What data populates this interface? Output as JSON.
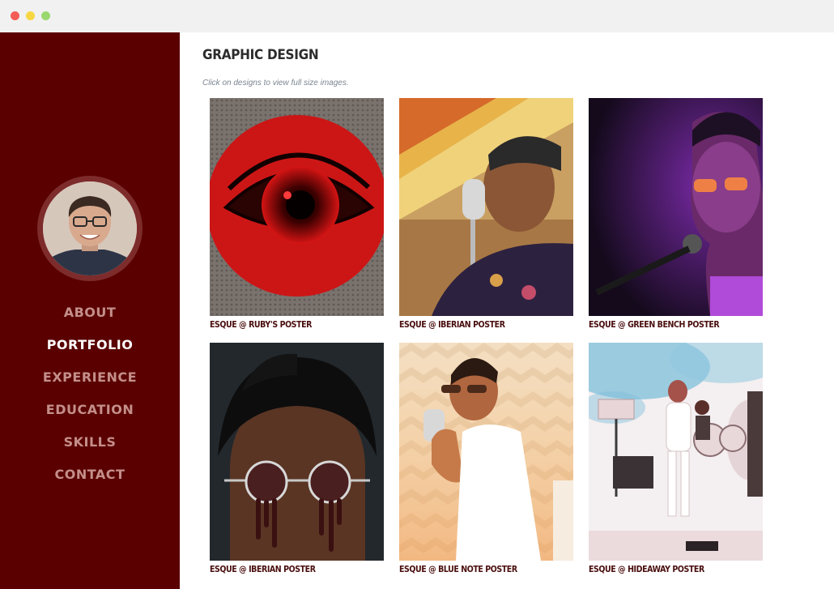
{
  "window": {
    "controls": [
      "close",
      "minimize",
      "maximize"
    ]
  },
  "sidebar": {
    "avatar": "profile-photo",
    "nav": [
      {
        "label": "ABOUT",
        "active": false
      },
      {
        "label": "PORTFOLIO",
        "active": true
      },
      {
        "label": "EXPERIENCE",
        "active": false
      },
      {
        "label": "EDUCATION",
        "active": false
      },
      {
        "label": "SKILLS",
        "active": false
      },
      {
        "label": "CONTACT",
        "active": false
      }
    ]
  },
  "main": {
    "title": "GRAPHIC DESIGN",
    "hint": "Click on designs to view full size images.",
    "gallery": [
      {
        "caption": "ESQUE @ RUBY'S POSTER"
      },
      {
        "caption": "ESQUE @ IBERIAN POSTER"
      },
      {
        "caption": "ESQUE @ GREEN BENCH POSTER"
      },
      {
        "caption": "ESQUE @ IBERIAN POSTER"
      },
      {
        "caption": "ESQUE @ BLUE NOTE POSTER"
      },
      {
        "caption": "ESQUE @ HIDEAWAY POSTER"
      }
    ]
  },
  "colors": {
    "sidebar": "#5a0000",
    "nav_inactive": "#c48f8a",
    "nav_active": "#ffffff",
    "caption": "#4a0e0e"
  }
}
